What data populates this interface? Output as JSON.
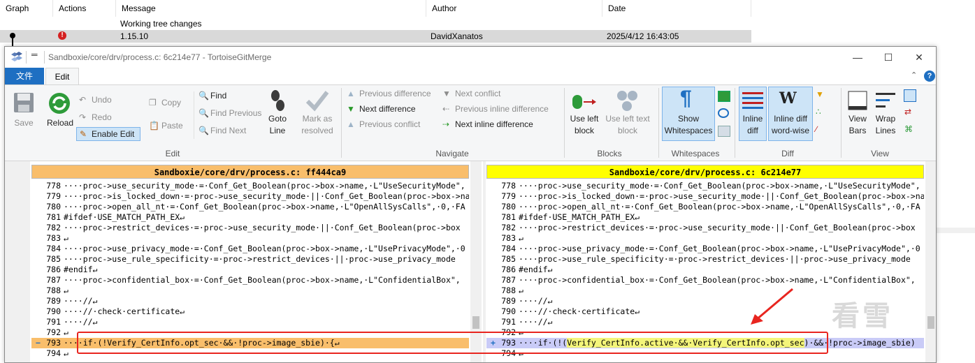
{
  "log": {
    "headers": [
      "Graph",
      "Actions",
      "Message",
      "Author",
      "Date"
    ],
    "row1": {
      "message": "Working tree changes"
    },
    "row2": {
      "message": "1.15.10",
      "author": "DavidXanatos",
      "date": "2025/4/12 16:43:05"
    }
  },
  "window": {
    "title": "Sandboxie/core/drv/process.c: 6c214e77 - TortoiseGitMerge",
    "min": "—",
    "max": "☐",
    "close": "✕"
  },
  "tabs": {
    "file": "文件",
    "edit": "Edit"
  },
  "ribbon": {
    "save": "Save",
    "reload": "Reload",
    "undo": "Undo",
    "redo": "Redo",
    "enable_edit": "Enable Edit",
    "copy": "Copy",
    "paste": "Paste",
    "find": "Find",
    "find_previous": "Find Previous",
    "find_next": "Find Next",
    "goto_line": "Goto\nLine",
    "goto_a": "Goto",
    "goto_b": "Line",
    "mark_a": "Mark as",
    "mark_b": "resolved",
    "prev_diff": "Previous difference",
    "next_diff": "Next difference",
    "prev_conflict": "Previous conflict",
    "next_conflict": "Next conflict",
    "prev_inline": "Previous inline difference",
    "next_inline": "Next inline difference",
    "use_left_a": "Use left",
    "use_left_b": "block",
    "use_left_text_a": "Use left text",
    "use_left_text_b": "block",
    "show_ws_a": "Show",
    "show_ws_b": "Whitespaces",
    "inline_a": "Inline",
    "inline_b": "diff",
    "inline_ww_a": "Inline diff",
    "inline_ww_b": "word-wise",
    "view_bars_a": "View",
    "view_bars_b": "Bars",
    "wrap_a": "Wrap",
    "wrap_b": "Lines",
    "groups": {
      "edit": "Edit",
      "navigate": "Navigate",
      "blocks": "Blocks",
      "whitespaces": "Whitespaces",
      "diff": "Diff",
      "view": "View"
    }
  },
  "left_pane": {
    "header": "Sandboxie/core/drv/process.c: ff444ca9",
    "lines": [
      {
        "n": "778",
        "t": "····proc->use_security_mode·=·Conf_Get_Boolean(proc->box->name,·L\"UseSecurityMode\","
      },
      {
        "n": "779",
        "t": "····proc->is_locked_down·=·proc->use_security_mode·||·Conf_Get_Boolean(proc->box->na"
      },
      {
        "n": "780",
        "t": "····proc->open_all_nt·=·Conf_Get_Boolean(proc->box->name,·L\"OpenAllSysCalls\",·0,·FA"
      },
      {
        "n": "781",
        "t": "#ifdef·USE_MATCH_PATH_EX↵"
      },
      {
        "n": "782",
        "t": "····proc->restrict_devices·=·proc->use_security_mode·||·Conf_Get_Boolean(proc->box"
      },
      {
        "n": "783",
        "t": "↵"
      },
      {
        "n": "784",
        "t": "····proc->use_privacy_mode·=·Conf_Get_Boolean(proc->box->name,·L\"UsePrivacyMode\",·0"
      },
      {
        "n": "785",
        "t": "····proc->use_rule_specificity·=·proc->restrict_devices·||·proc->use_privacy_mode"
      },
      {
        "n": "786",
        "t": "#endif↵"
      },
      {
        "n": "787",
        "t": "····proc->confidential_box·=·Conf_Get_Boolean(proc->box->name,·L\"ConfidentialBox\","
      },
      {
        "n": "788",
        "t": "↵"
      },
      {
        "n": "789",
        "t": "····//↵"
      },
      {
        "n": "790",
        "t": "····//·check·certificate↵"
      },
      {
        "n": "791",
        "t": "····//↵"
      },
      {
        "n": "792",
        "t": "↵"
      },
      {
        "n": "793",
        "t": "····if·(!Verify_CertInfo.opt_sec·&&·!proc->image_sbie)·{↵"
      },
      {
        "n": "794",
        "t": "↵"
      }
    ]
  },
  "right_pane": {
    "header": "Sandboxie/core/drv/process.c: 6c214e77",
    "lines": [
      {
        "n": "778",
        "t": "····proc->use_security_mode·=·Conf_Get_Boolean(proc->box->name,·L\"UseSecurityMode\","
      },
      {
        "n": "779",
        "t": "····proc->is_locked_down·=·proc->use_security_mode·||·Conf_Get_Boolean(proc->box->na"
      },
      {
        "n": "780",
        "t": "····proc->open_all_nt·=·Conf_Get_Boolean(proc->box->name,·L\"OpenAllSysCalls\",·0,·FA"
      },
      {
        "n": "781",
        "t": "#ifdef·USE_MATCH_PATH_EX↵"
      },
      {
        "n": "782",
        "t": "····proc->restrict_devices·=·proc->use_security_mode·||·Conf_Get_Boolean(proc->box"
      },
      {
        "n": "783",
        "t": "↵"
      },
      {
        "n": "784",
        "t": "····proc->use_privacy_mode·=·Conf_Get_Boolean(proc->box->name,·L\"UsePrivacyMode\",·0"
      },
      {
        "n": "785",
        "t": "····proc->use_rule_specificity·=·proc->restrict_devices·||·proc->use_privacy_mode"
      },
      {
        "n": "786",
        "t": "#endif↵"
      },
      {
        "n": "787",
        "t": "····proc->confidential_box·=·Conf_Get_Boolean(proc->box->name,·L\"ConfidentialBox\","
      },
      {
        "n": "788",
        "t": "↵"
      },
      {
        "n": "789",
        "t": "····//↵"
      },
      {
        "n": "790",
        "t": "····//·check·certificate↵"
      },
      {
        "n": "791",
        "t": "····//↵"
      },
      {
        "n": "792",
        "t": "↵"
      },
      {
        "n": "793",
        "t": "····if·(!(Verify_CertInfo.active·&&·Verify_CertInfo.opt_sec)·&&·!proc->image_sbie)"
      },
      {
        "n": "794",
        "t": "↵"
      }
    ]
  },
  "changed_line": {
    "left_marker": "−",
    "right_marker": "+",
    "right_parts": [
      "····if·(!(",
      "Verify_CertInfo.active·&&·Verify_CertInfo.opt_sec",
      ")·&&·!proc->image_sbie)"
    ]
  },
  "watermark": "看雪",
  "colors": {
    "left_header": "#f9be6b",
    "right_header": "#ffff00",
    "changed_left": "#f9be6b",
    "changed_right": "#c9cbf7",
    "inline_change": "#f4f57a",
    "annotation": "#e8251f",
    "file_tab": "#1e6fc2"
  }
}
